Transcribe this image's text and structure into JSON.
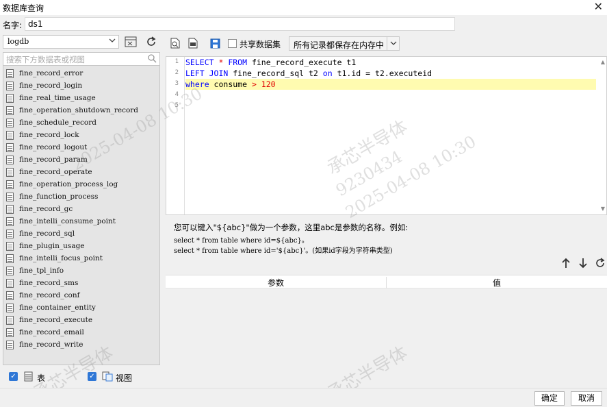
{
  "window": {
    "title": "数据库查询",
    "close_glyph": "✕"
  },
  "name_field": {
    "label": "名字:",
    "value": "ds1"
  },
  "left": {
    "database": "logdb",
    "search_placeholder": "搜索下方数据表或视图",
    "tables": [
      "fine_record_error",
      "fine_record_login",
      "fine_real_time_usage",
      "fine_operation_shutdown_record",
      "fine_schedule_record",
      "fine_record_lock",
      "fine_record_logout",
      "fine_record_param",
      "fine_record_operate",
      "fine_operation_process_log",
      "fine_function_process",
      "fine_record_gc",
      "fine_intelli_consume_point",
      "fine_record_sql",
      "fine_plugin_usage",
      "fine_intelli_focus_point",
      "fine_tpl_info",
      "fine_record_sms",
      "fine_record_conf",
      "fine_container_entity",
      "fine_record_execute",
      "fine_record_email",
      "fine_record_write"
    ],
    "filter_table_label": "表",
    "filter_view_label": "视图"
  },
  "toolbar": {
    "share_label": "共享数据集",
    "memory_option": "所有记录都保存在内存中"
  },
  "editor": {
    "line_numbers": [
      "1",
      "2",
      "3",
      "4",
      "5"
    ],
    "line1": {
      "kw1": "SELECT",
      "op": " * ",
      "kw2": "FROM",
      "rest": " fine_record_execute t1"
    },
    "line2": {
      "kw1": "LEFT JOIN",
      "mid": " fine_record_sql t2 ",
      "kw2": "on",
      "rest": " t1.id = t2.executeid"
    },
    "line3": {
      "kw1": "where",
      "mid": " consume ",
      "op": ">",
      "num": " 120"
    }
  },
  "help": {
    "line1": "您可以键入\"${abc}\"做为一个参数，这里abc是参数的名称。例如:",
    "line2": "select * from table where id=${abc}。",
    "line3": "select * from table where id='${abc}'。(如果id字段为字符串类型)"
  },
  "params": {
    "col_param": "参数",
    "col_value": "值"
  },
  "buttons": {
    "ok": "确定",
    "cancel": "取消"
  },
  "watermark": {
    "company": "承芯半导体",
    "id": "9230434",
    "datetime": "2025-04-08 10:30"
  },
  "colors": {
    "checkbox": "#2f77d6",
    "keyword": "#0000ff",
    "operator": "#e00000",
    "highlight": "#fffbb0"
  }
}
